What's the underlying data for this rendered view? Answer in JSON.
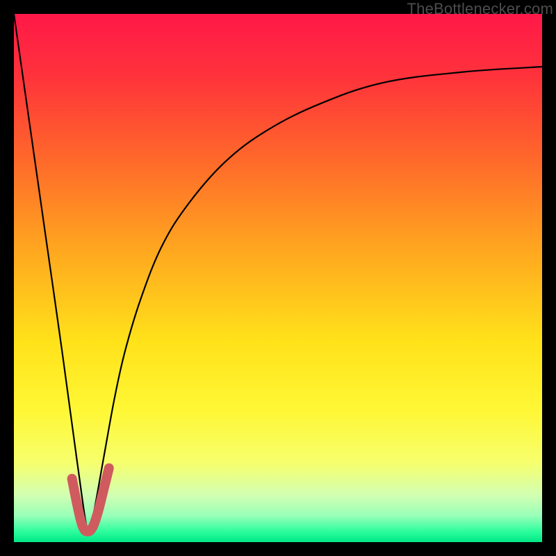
{
  "watermark": "TheBottlenecker.com",
  "colors": {
    "bg": "#000000",
    "curve_main": "#000000",
    "curve_marker": "#cf5b5f",
    "watermark": "#4d4d4d",
    "gradient_stops": [
      {
        "pos": 0.0,
        "color": "#ff1848"
      },
      {
        "pos": 0.12,
        "color": "#ff333b"
      },
      {
        "pos": 0.28,
        "color": "#ff6a2a"
      },
      {
        "pos": 0.45,
        "color": "#ffa81f"
      },
      {
        "pos": 0.62,
        "color": "#ffe21a"
      },
      {
        "pos": 0.75,
        "color": "#fff735"
      },
      {
        "pos": 0.85,
        "color": "#f6ff6d"
      },
      {
        "pos": 0.91,
        "color": "#d3ffb1"
      },
      {
        "pos": 0.95,
        "color": "#99ffb9"
      },
      {
        "pos": 0.98,
        "color": "#2dfd9d"
      },
      {
        "pos": 1.0,
        "color": "#00e885"
      }
    ]
  },
  "chart_data": {
    "type": "line",
    "title": "",
    "xlabel": "",
    "ylabel": "",
    "xlim": [
      0,
      100
    ],
    "ylim": [
      0,
      100
    ],
    "grid": false,
    "legend": false,
    "notes": "V-shaped curve. Left branch descends steeply from top-left to a minimum near x≈14, y≈2. Right branch rises with decreasing slope toward y≈90 at x=100. Thick reddish marker stroke highlights the region around the minimum (approx x 12–18).",
    "series": [
      {
        "name": "main-curve",
        "x": [
          0,
          3,
          6,
          9,
          12,
          14,
          15,
          17,
          19,
          21,
          24,
          28,
          33,
          40,
          48,
          58,
          70,
          85,
          100
        ],
        "y": [
          100,
          79,
          58,
          37,
          15,
          2,
          5,
          16,
          27,
          36,
          46,
          56,
          64,
          72,
          78,
          83,
          87,
          89,
          90
        ]
      },
      {
        "name": "highlight-marker",
        "x": [
          11,
          12,
          13,
          14,
          15,
          16,
          17,
          18
        ],
        "y": [
          12,
          7,
          3,
          2,
          3,
          6,
          10,
          14
        ]
      }
    ]
  }
}
